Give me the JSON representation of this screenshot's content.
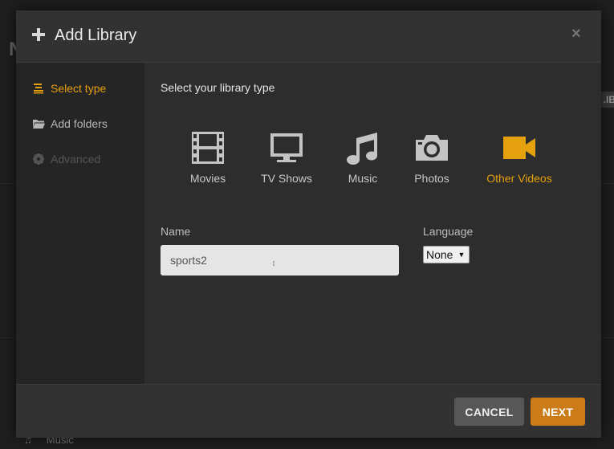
{
  "background": {
    "letter": "N",
    "tag": ".IB",
    "footer_label": "Music"
  },
  "dialog": {
    "title": "Add Library",
    "close_glyph": "×"
  },
  "sidebar": {
    "items": [
      {
        "label": "Select type",
        "icon": "list-icon",
        "state": "active"
      },
      {
        "label": "Add folders",
        "icon": "folder-icon",
        "state": "normal"
      },
      {
        "label": "Advanced",
        "icon": "gear-icon",
        "state": "disabled"
      }
    ]
  },
  "main": {
    "prompt": "Select your library type",
    "types": [
      {
        "label": "Movies",
        "icon": "film-icon"
      },
      {
        "label": "TV Shows",
        "icon": "tv-icon"
      },
      {
        "label": "Music",
        "icon": "music-icon"
      },
      {
        "label": "Photos",
        "icon": "camera-icon"
      },
      {
        "label": "Other Videos",
        "icon": "video-camera-icon",
        "selected": true
      }
    ],
    "name_label": "Name",
    "name_value": "sports2",
    "language_label": "Language",
    "language_value": "None"
  },
  "footer": {
    "cancel_label": "CANCEL",
    "next_label": "NEXT"
  },
  "colors": {
    "accent": "#e5a00d",
    "next_button": "#cc7b19",
    "cancel_button": "#575757"
  }
}
